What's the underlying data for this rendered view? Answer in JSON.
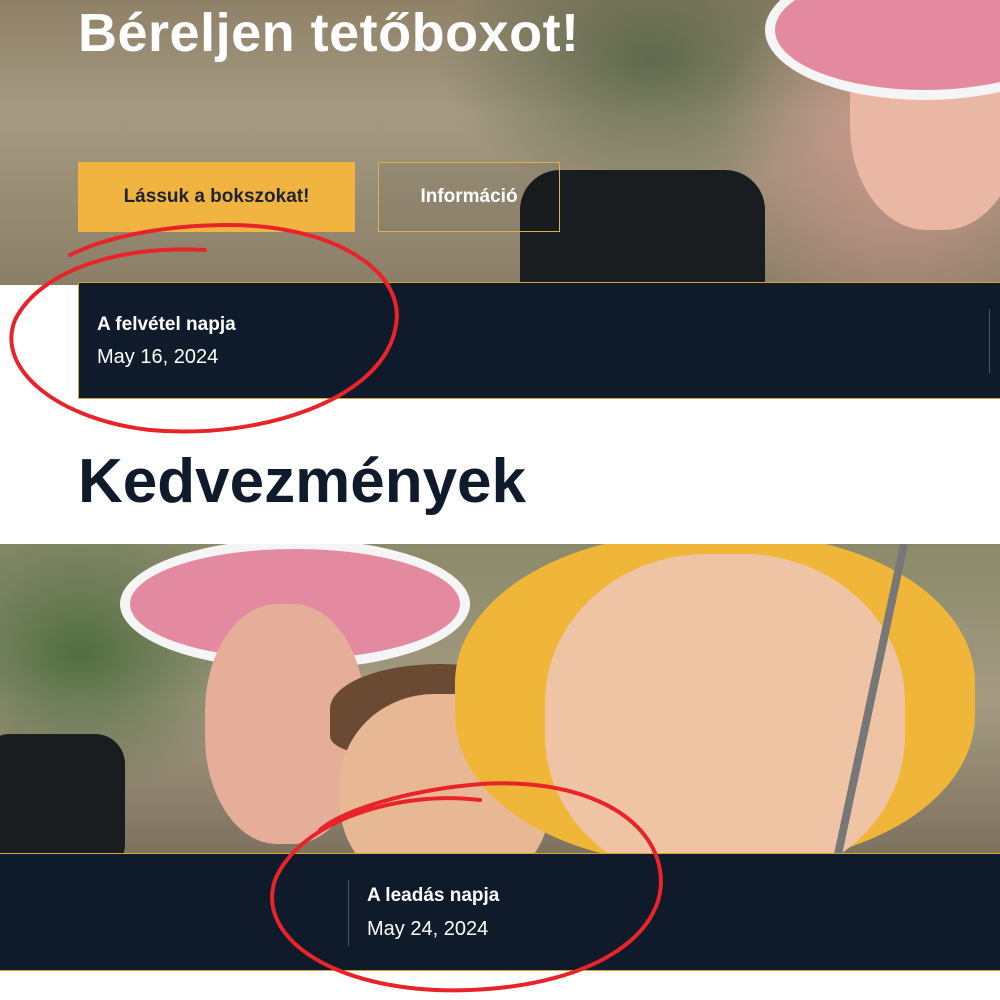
{
  "hero": {
    "title": "Béreljen tetőboxot!",
    "primary_button": "Lássuk a bokszokat!",
    "secondary_button": "Információ"
  },
  "pickup": {
    "label": "A felvétel napja",
    "date": "May 16, 2024"
  },
  "discounts_heading": "Kedvezmények",
  "dropoff": {
    "label": "A leadás napja",
    "date": "May 24, 2024"
  },
  "colors": {
    "accent": "#f2b441",
    "dark_navy": "#0f1b2a",
    "annotation_red": "#e8242a"
  }
}
